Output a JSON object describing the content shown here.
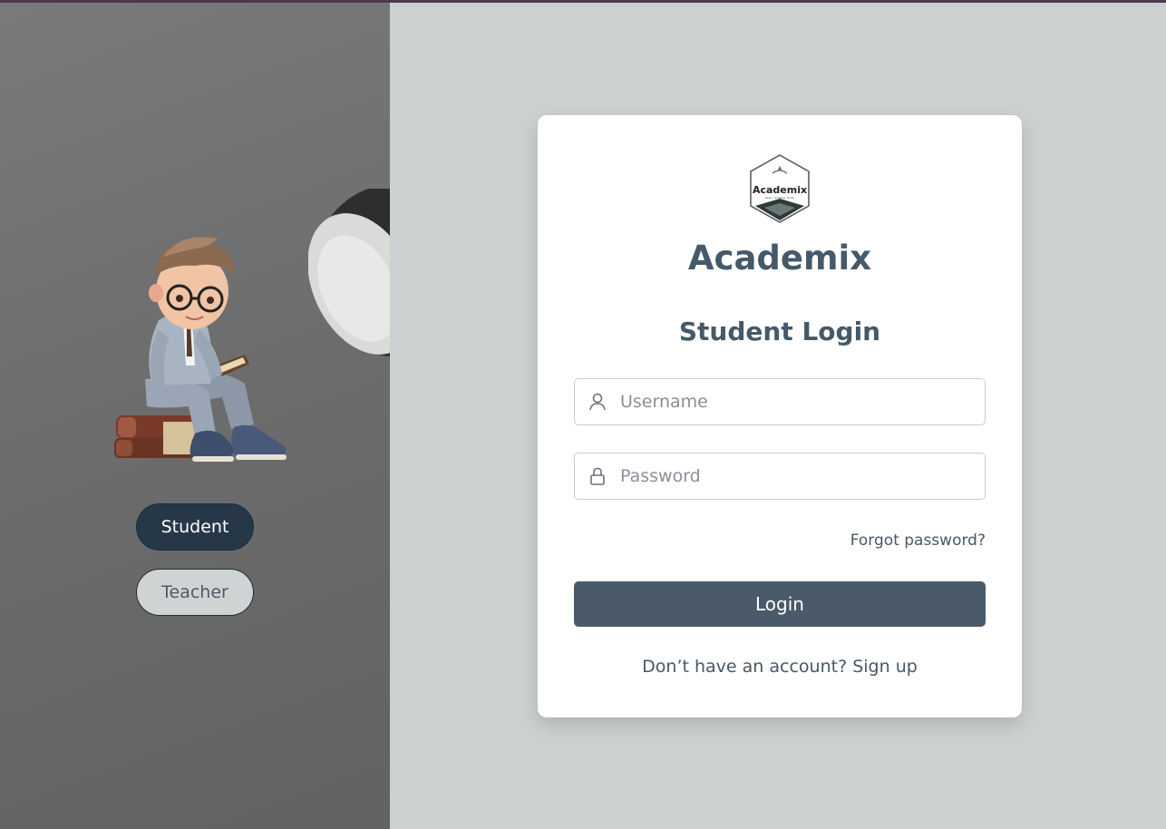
{
  "roles": {
    "student_label": "Student",
    "teacher_label": "Teacher",
    "selected": "Student"
  },
  "brand": {
    "name": "Academix",
    "logo_text": "Academix",
    "logo_tagline": "Learn. Achieve. Grow."
  },
  "login": {
    "title": "Student Login",
    "username_placeholder": "Username",
    "password_placeholder": "Password",
    "username_value": "",
    "password_value": "",
    "forgot_label": "Forgot password?",
    "submit_label": "Login",
    "signup_prompt": "Don’t have an account?",
    "signup_link": "Sign up"
  },
  "icons": {
    "username": "user-icon",
    "password": "lock-icon"
  },
  "colors": {
    "primary_dark": "#263848",
    "button": "#4a5a6a",
    "heading": "#45596a",
    "background": "#cdd0d0"
  }
}
